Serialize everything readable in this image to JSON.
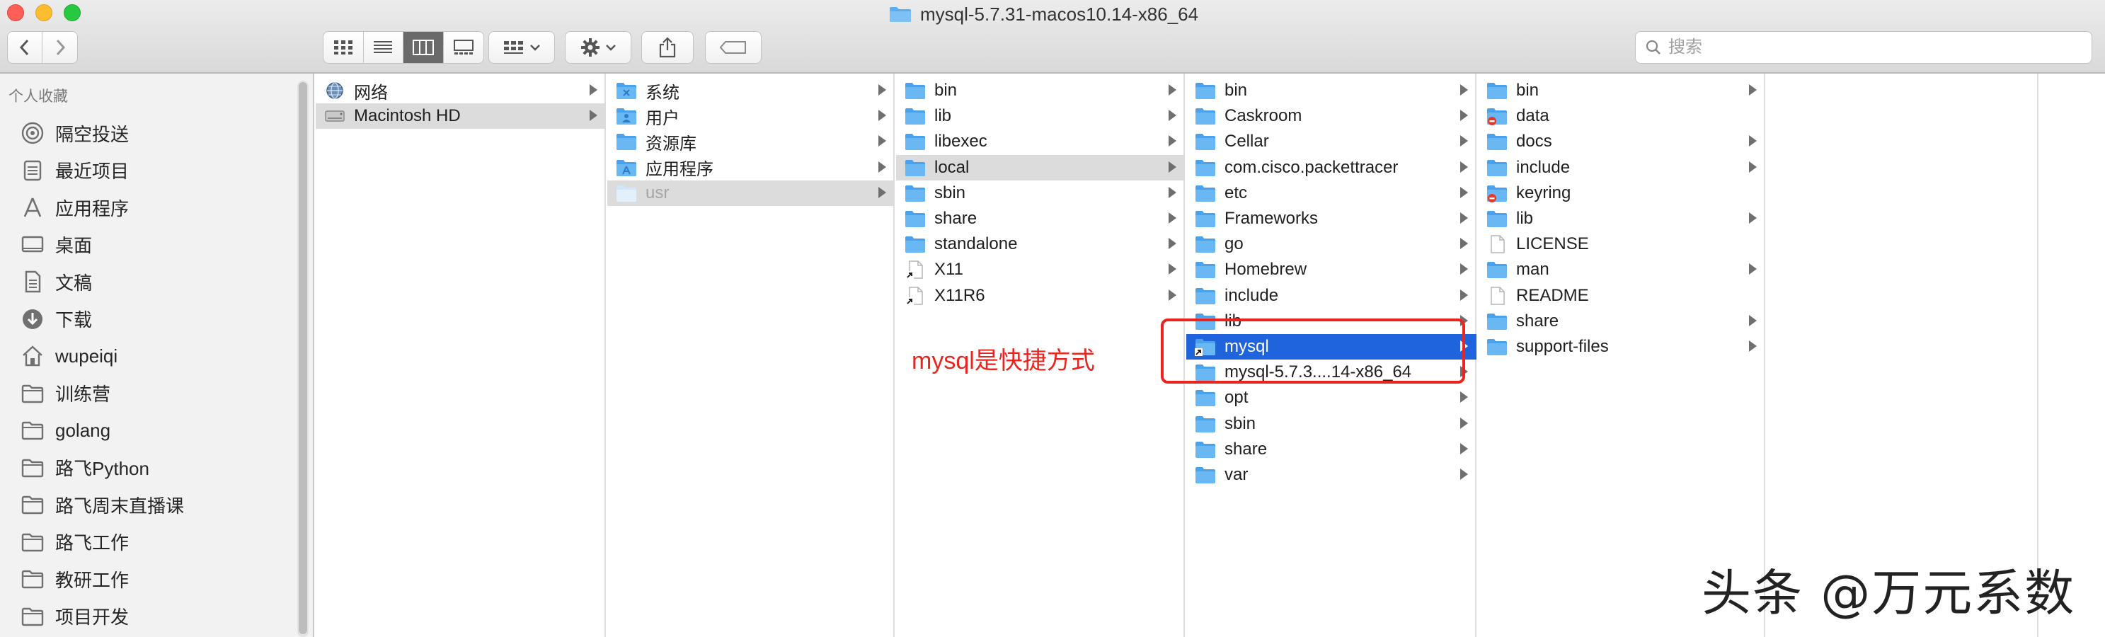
{
  "window": {
    "title": "mysql-5.7.31-macos10.14-x86_64"
  },
  "toolbar": {
    "back_icon": "chevron-left-icon",
    "forward_icon": "chevron-right-icon",
    "view_modes": [
      "icon-view-icon",
      "list-view-icon",
      "column-view-icon",
      "gallery-view-icon"
    ],
    "active_view": "column-view-icon",
    "search": {
      "placeholder": "搜索",
      "value": ""
    }
  },
  "sidebar": {
    "heading": "个人收藏",
    "items": [
      {
        "label": "隔空投送",
        "icon": "airdrop-icon"
      },
      {
        "label": "最近项目",
        "icon": "recents-icon"
      },
      {
        "label": "应用程序",
        "icon": "applications-icon"
      },
      {
        "label": "桌面",
        "icon": "desktop-icon"
      },
      {
        "label": "文稿",
        "icon": "documents-icon"
      },
      {
        "label": "下载",
        "icon": "downloads-icon"
      },
      {
        "label": "wupeiqi",
        "icon": "home-icon"
      },
      {
        "label": "训练营",
        "icon": "folder-icon"
      },
      {
        "label": "golang",
        "icon": "folder-icon"
      },
      {
        "label": "路飞Python",
        "icon": "folder-icon"
      },
      {
        "label": "路飞周末直播课",
        "icon": "folder-icon"
      },
      {
        "label": "路飞工作",
        "icon": "folder-icon"
      },
      {
        "label": "教研工作",
        "icon": "folder-icon"
      },
      {
        "label": "项目开发",
        "icon": "folder-icon"
      }
    ]
  },
  "columns": [
    {
      "items": [
        {
          "label": "网络",
          "kind": "network",
          "arrow": true
        },
        {
          "label": "Macintosh HD",
          "kind": "disk",
          "arrow": true,
          "state": "selected-gray"
        }
      ]
    },
    {
      "items": [
        {
          "label": "系统",
          "kind": "folder-x",
          "arrow": true
        },
        {
          "label": "用户",
          "kind": "folder-user",
          "arrow": true
        },
        {
          "label": "资源库",
          "kind": "folder",
          "arrow": true
        },
        {
          "label": "应用程序",
          "kind": "folder-app",
          "arrow": true
        },
        {
          "label": "usr",
          "kind": "folder-light",
          "arrow": true,
          "state": "selected-gray-dim"
        }
      ]
    },
    {
      "items": [
        {
          "label": "bin",
          "kind": "folder",
          "arrow": true
        },
        {
          "label": "lib",
          "kind": "folder",
          "arrow": true
        },
        {
          "label": "libexec",
          "kind": "folder",
          "arrow": true
        },
        {
          "label": "local",
          "kind": "folder",
          "arrow": true,
          "state": "selected-gray"
        },
        {
          "label": "sbin",
          "kind": "folder",
          "arrow": true
        },
        {
          "label": "share",
          "kind": "folder",
          "arrow": true
        },
        {
          "label": "standalone",
          "kind": "folder",
          "arrow": true
        },
        {
          "label": "X11",
          "kind": "alias-file",
          "arrow": true
        },
        {
          "label": "X11R6",
          "kind": "alias-file",
          "arrow": true
        }
      ]
    },
    {
      "items": [
        {
          "label": "bin",
          "kind": "folder",
          "arrow": true
        },
        {
          "label": "Caskroom",
          "kind": "folder",
          "arrow": true
        },
        {
          "label": "Cellar",
          "kind": "folder",
          "arrow": true
        },
        {
          "label": "com.cisco.packettracer",
          "kind": "folder",
          "arrow": true
        },
        {
          "label": "etc",
          "kind": "folder",
          "arrow": true
        },
        {
          "label": "Frameworks",
          "kind": "folder",
          "arrow": true
        },
        {
          "label": "go",
          "kind": "folder",
          "arrow": true
        },
        {
          "label": "Homebrew",
          "kind": "folder",
          "arrow": true
        },
        {
          "label": "include",
          "kind": "folder",
          "arrow": true
        },
        {
          "label": "lib",
          "kind": "folder",
          "arrow": true
        },
        {
          "label": "mysql",
          "kind": "alias-folder",
          "arrow": true,
          "state": "selected-blue"
        },
        {
          "label": "mysql-5.7.3....14-x86_64",
          "kind": "folder",
          "arrow": true
        },
        {
          "label": "opt",
          "kind": "folder",
          "arrow": true
        },
        {
          "label": "sbin",
          "kind": "folder",
          "arrow": true
        },
        {
          "label": "share",
          "kind": "folder",
          "arrow": true
        },
        {
          "label": "var",
          "kind": "folder",
          "arrow": true
        }
      ]
    },
    {
      "items": [
        {
          "label": "bin",
          "kind": "folder",
          "arrow": true
        },
        {
          "label": "data",
          "kind": "folder-locked",
          "arrow": false
        },
        {
          "label": "docs",
          "kind": "folder",
          "arrow": true
        },
        {
          "label": "include",
          "kind": "folder",
          "arrow": true
        },
        {
          "label": "keyring",
          "kind": "folder-locked",
          "arrow": false
        },
        {
          "label": "lib",
          "kind": "folder",
          "arrow": true
        },
        {
          "label": "LICENSE",
          "kind": "file",
          "arrow": false
        },
        {
          "label": "man",
          "kind": "folder",
          "arrow": true
        },
        {
          "label": "README",
          "kind": "file",
          "arrow": false
        },
        {
          "label": "share",
          "kind": "folder",
          "arrow": true
        },
        {
          "label": "support-files",
          "kind": "folder",
          "arrow": true
        }
      ]
    },
    {
      "items": []
    },
    {
      "items": []
    }
  ],
  "annotation": {
    "text": "mysql是快捷方式"
  },
  "watermark": {
    "text": "头条 @万元系数"
  },
  "colors": {
    "folder": "#5aaef0",
    "folder_dark": "#3e94dc",
    "selection_blue": "#1f63dd",
    "selection_gray": "#dcdcdc",
    "annotation_red": "#e8251f"
  }
}
